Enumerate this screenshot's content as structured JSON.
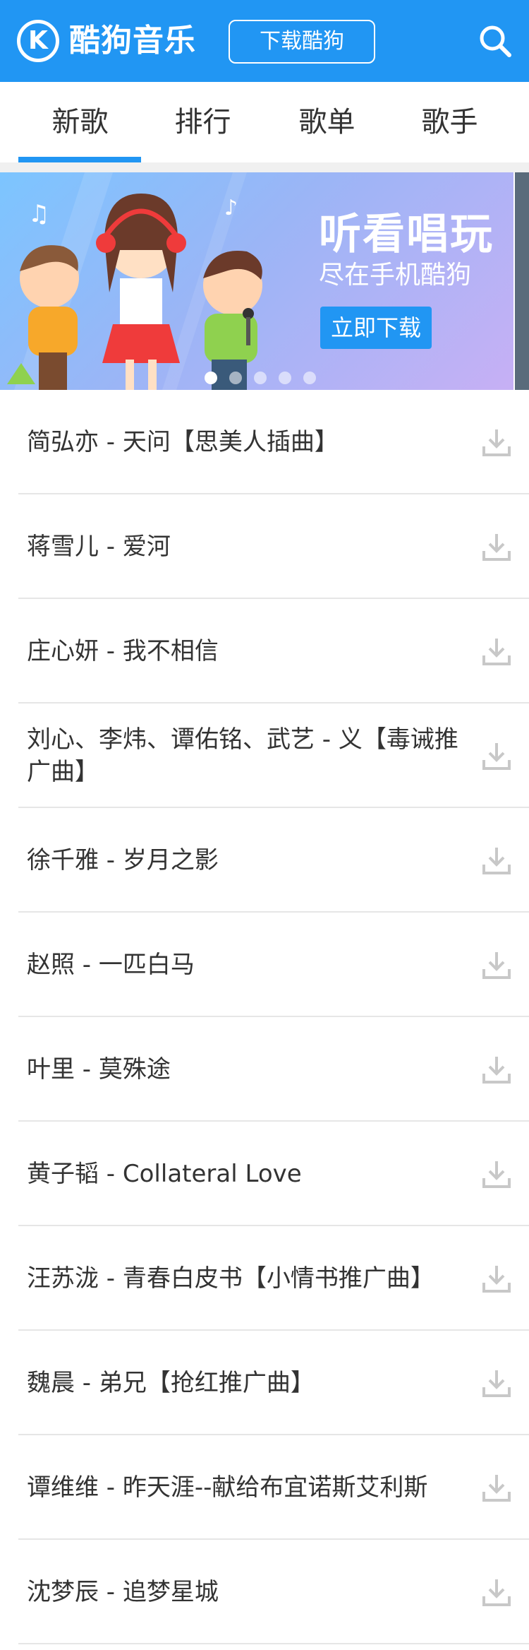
{
  "header": {
    "logo_letter": "K",
    "app_name": "酷狗音乐",
    "download_button": "下载酷狗"
  },
  "tabs": [
    {
      "label": "新歌",
      "active": true
    },
    {
      "label": "排行",
      "active": false
    },
    {
      "label": "歌单",
      "active": false
    },
    {
      "label": "歌手",
      "active": false
    }
  ],
  "banner": {
    "title": "听看唱玩",
    "subtitle": "尽在手机酷狗",
    "button": "立即下载",
    "slide_count": 5,
    "active_slide": 1
  },
  "songs": [
    "简弘亦 - 天问【思美人插曲】",
    "蒋雪儿 - 爱河",
    "庄心妍 - 我不相信",
    "刘心、李炜、谭佑铭、武艺 - 义【毒诫推广曲】",
    "徐千雅 - 岁月之影",
    "赵照 - 一匹白马",
    "叶里 - 莫殊途",
    "黄子韬 - Collateral Love",
    "汪苏泷 - 青春白皮书【小情书推广曲】",
    "魏晨 - 弟兄【抢红推广曲】",
    "谭维维 - 昨天涯--献给布宜诺斯艾利斯",
    "沈梦辰 - 追梦星城"
  ],
  "colors": {
    "brand_blue": "#2196f3",
    "divider": "#e6e6e6",
    "icon_gray": "#c8c8c8"
  },
  "icons": {
    "logo": "kugou-logo-icon",
    "search": "search-icon",
    "download": "download-icon"
  }
}
